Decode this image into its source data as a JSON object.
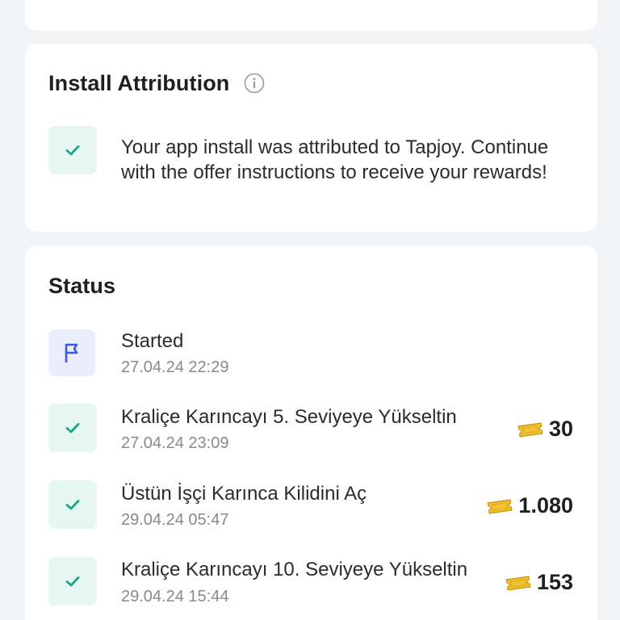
{
  "install_attribution": {
    "title": "Install Attribution",
    "message": "Your app install was attributed to Tapjoy. Continue with the offer instructions to receive your rewards!"
  },
  "status": {
    "title": "Status",
    "rows": [
      {
        "title": "Started",
        "date": "27.04.24 22:29",
        "icon": "flag-icon"
      },
      {
        "title": "Kraliçe Karıncayı 5. Seviyeye Yükseltin",
        "date": "27.04.24 23:09",
        "icon": "check-icon",
        "reward": "30"
      },
      {
        "title": "Üstün İşçi Karınca Kilidini Aç",
        "date": "29.04.24 05:47",
        "icon": "check-icon",
        "reward": "1.080"
      },
      {
        "title": "Kraliçe Karıncayı 10. Seviyeye Yükseltin",
        "date": "29.04.24 15:44",
        "icon": "check-icon",
        "reward": "153"
      }
    ]
  },
  "colors": {
    "check_green": "#1ba784",
    "check_bg": "#e6f6f1",
    "flag_blue": "#3b5bdb",
    "flag_bg": "#e9edfb",
    "ticket_gold": "#f1c232"
  }
}
